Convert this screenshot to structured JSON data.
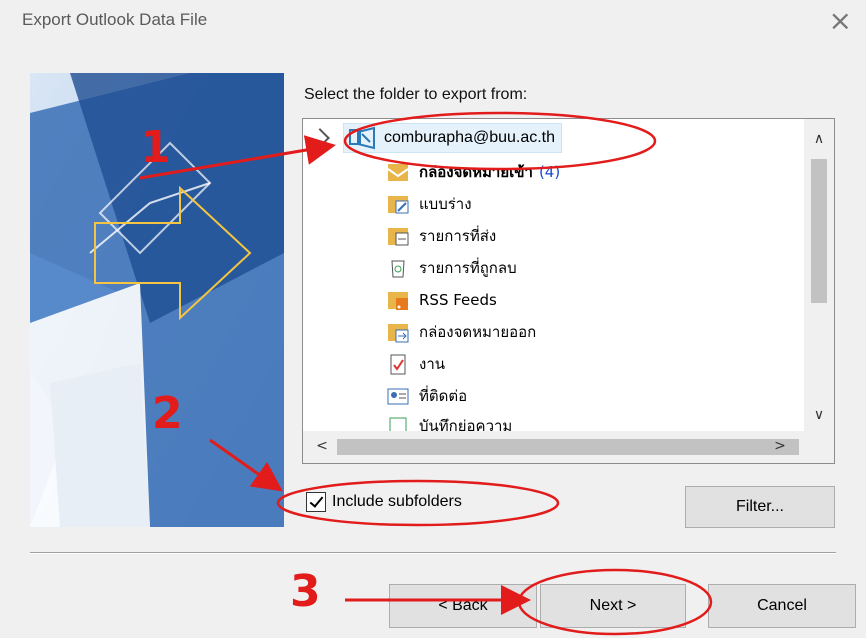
{
  "window": {
    "title": "Export Outlook Data File",
    "close_glyph": "×"
  },
  "prompt": "Select the folder to export from:",
  "tree": {
    "root": {
      "label": "comburapha@buu.ac.th",
      "icon": "account-icon"
    },
    "items": [
      {
        "label": "กล่องจดหมายเข้า",
        "count": "(4)",
        "bold": true,
        "icon": "inbox-folder-icon"
      },
      {
        "label": "แบบร่าง",
        "count": "",
        "bold": false,
        "icon": "drafts-folder-icon"
      },
      {
        "label": "รายการที่ส่ง",
        "count": "",
        "bold": false,
        "icon": "sent-items-folder-icon"
      },
      {
        "label": "รายการที่ถูกลบ",
        "count": "",
        "bold": false,
        "icon": "deleted-items-icon"
      },
      {
        "label": "RSS Feeds",
        "count": "",
        "bold": false,
        "icon": "rss-folder-icon"
      },
      {
        "label": "กล่องจดหมายออก",
        "count": "",
        "bold": false,
        "icon": "outbox-folder-icon"
      },
      {
        "label": "งาน",
        "count": "",
        "bold": false,
        "icon": "tasks-icon"
      },
      {
        "label": "ที่ติดต่อ",
        "count": "",
        "bold": false,
        "icon": "contacts-icon"
      },
      {
        "label": "บันทึกย่อความ",
        "count": "",
        "bold": false,
        "icon": "notes-icon"
      }
    ],
    "scroll_up": "∧",
    "scroll_down": "∨",
    "scroll_left": "<",
    "scroll_right": ">"
  },
  "include_subfolders": {
    "label": "Include subfolders",
    "checked": true
  },
  "buttons": {
    "filter": "Filter...",
    "back": "< Back",
    "next": "Next >",
    "cancel": "Cancel"
  },
  "annotations": {
    "one": "1",
    "two": "2",
    "three": "3",
    "color": "#e21b1b"
  }
}
